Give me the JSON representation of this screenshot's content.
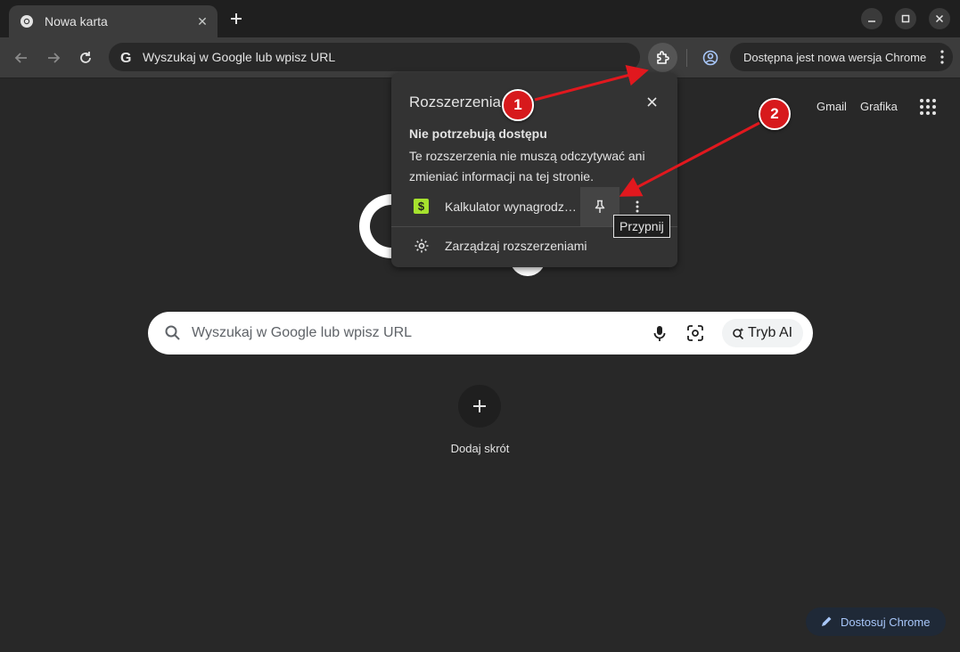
{
  "tab": {
    "title": "Nowa karta"
  },
  "omnibox": {
    "text": "Wyszukaj w Google lub wpisz URL"
  },
  "update_chip": {
    "label": "Dostępna jest nowa wersja Chrome"
  },
  "ntp": {
    "links": {
      "gmail": "Gmail",
      "images": "Grafika"
    },
    "search_placeholder": "Wyszukaj w Google lub wpisz URL",
    "ai_mode_label": "Tryb AI",
    "shortcut_label": "Dodaj skrót",
    "customize_label": "Dostosuj Chrome"
  },
  "extensions_popup": {
    "title": "Rozszerzenia",
    "section_heading": "Nie potrzebują dostępu",
    "section_desc": "Te rozszerzenia nie muszą odczytywać ani zmieniać informacji na tej stronie.",
    "items": [
      {
        "name": "Kalkulator wynagrodzeń",
        "icon_glyph": "$"
      }
    ],
    "manage_label": "Zarządzaj rozszerzeniami",
    "pin_tooltip": "Przypnij"
  },
  "annotations": {
    "badge_1": "1",
    "badge_2": "2"
  },
  "colors": {
    "accent": "#a8c7fa",
    "badge": "#d7191c",
    "ext_icon": "#a6e22e"
  }
}
